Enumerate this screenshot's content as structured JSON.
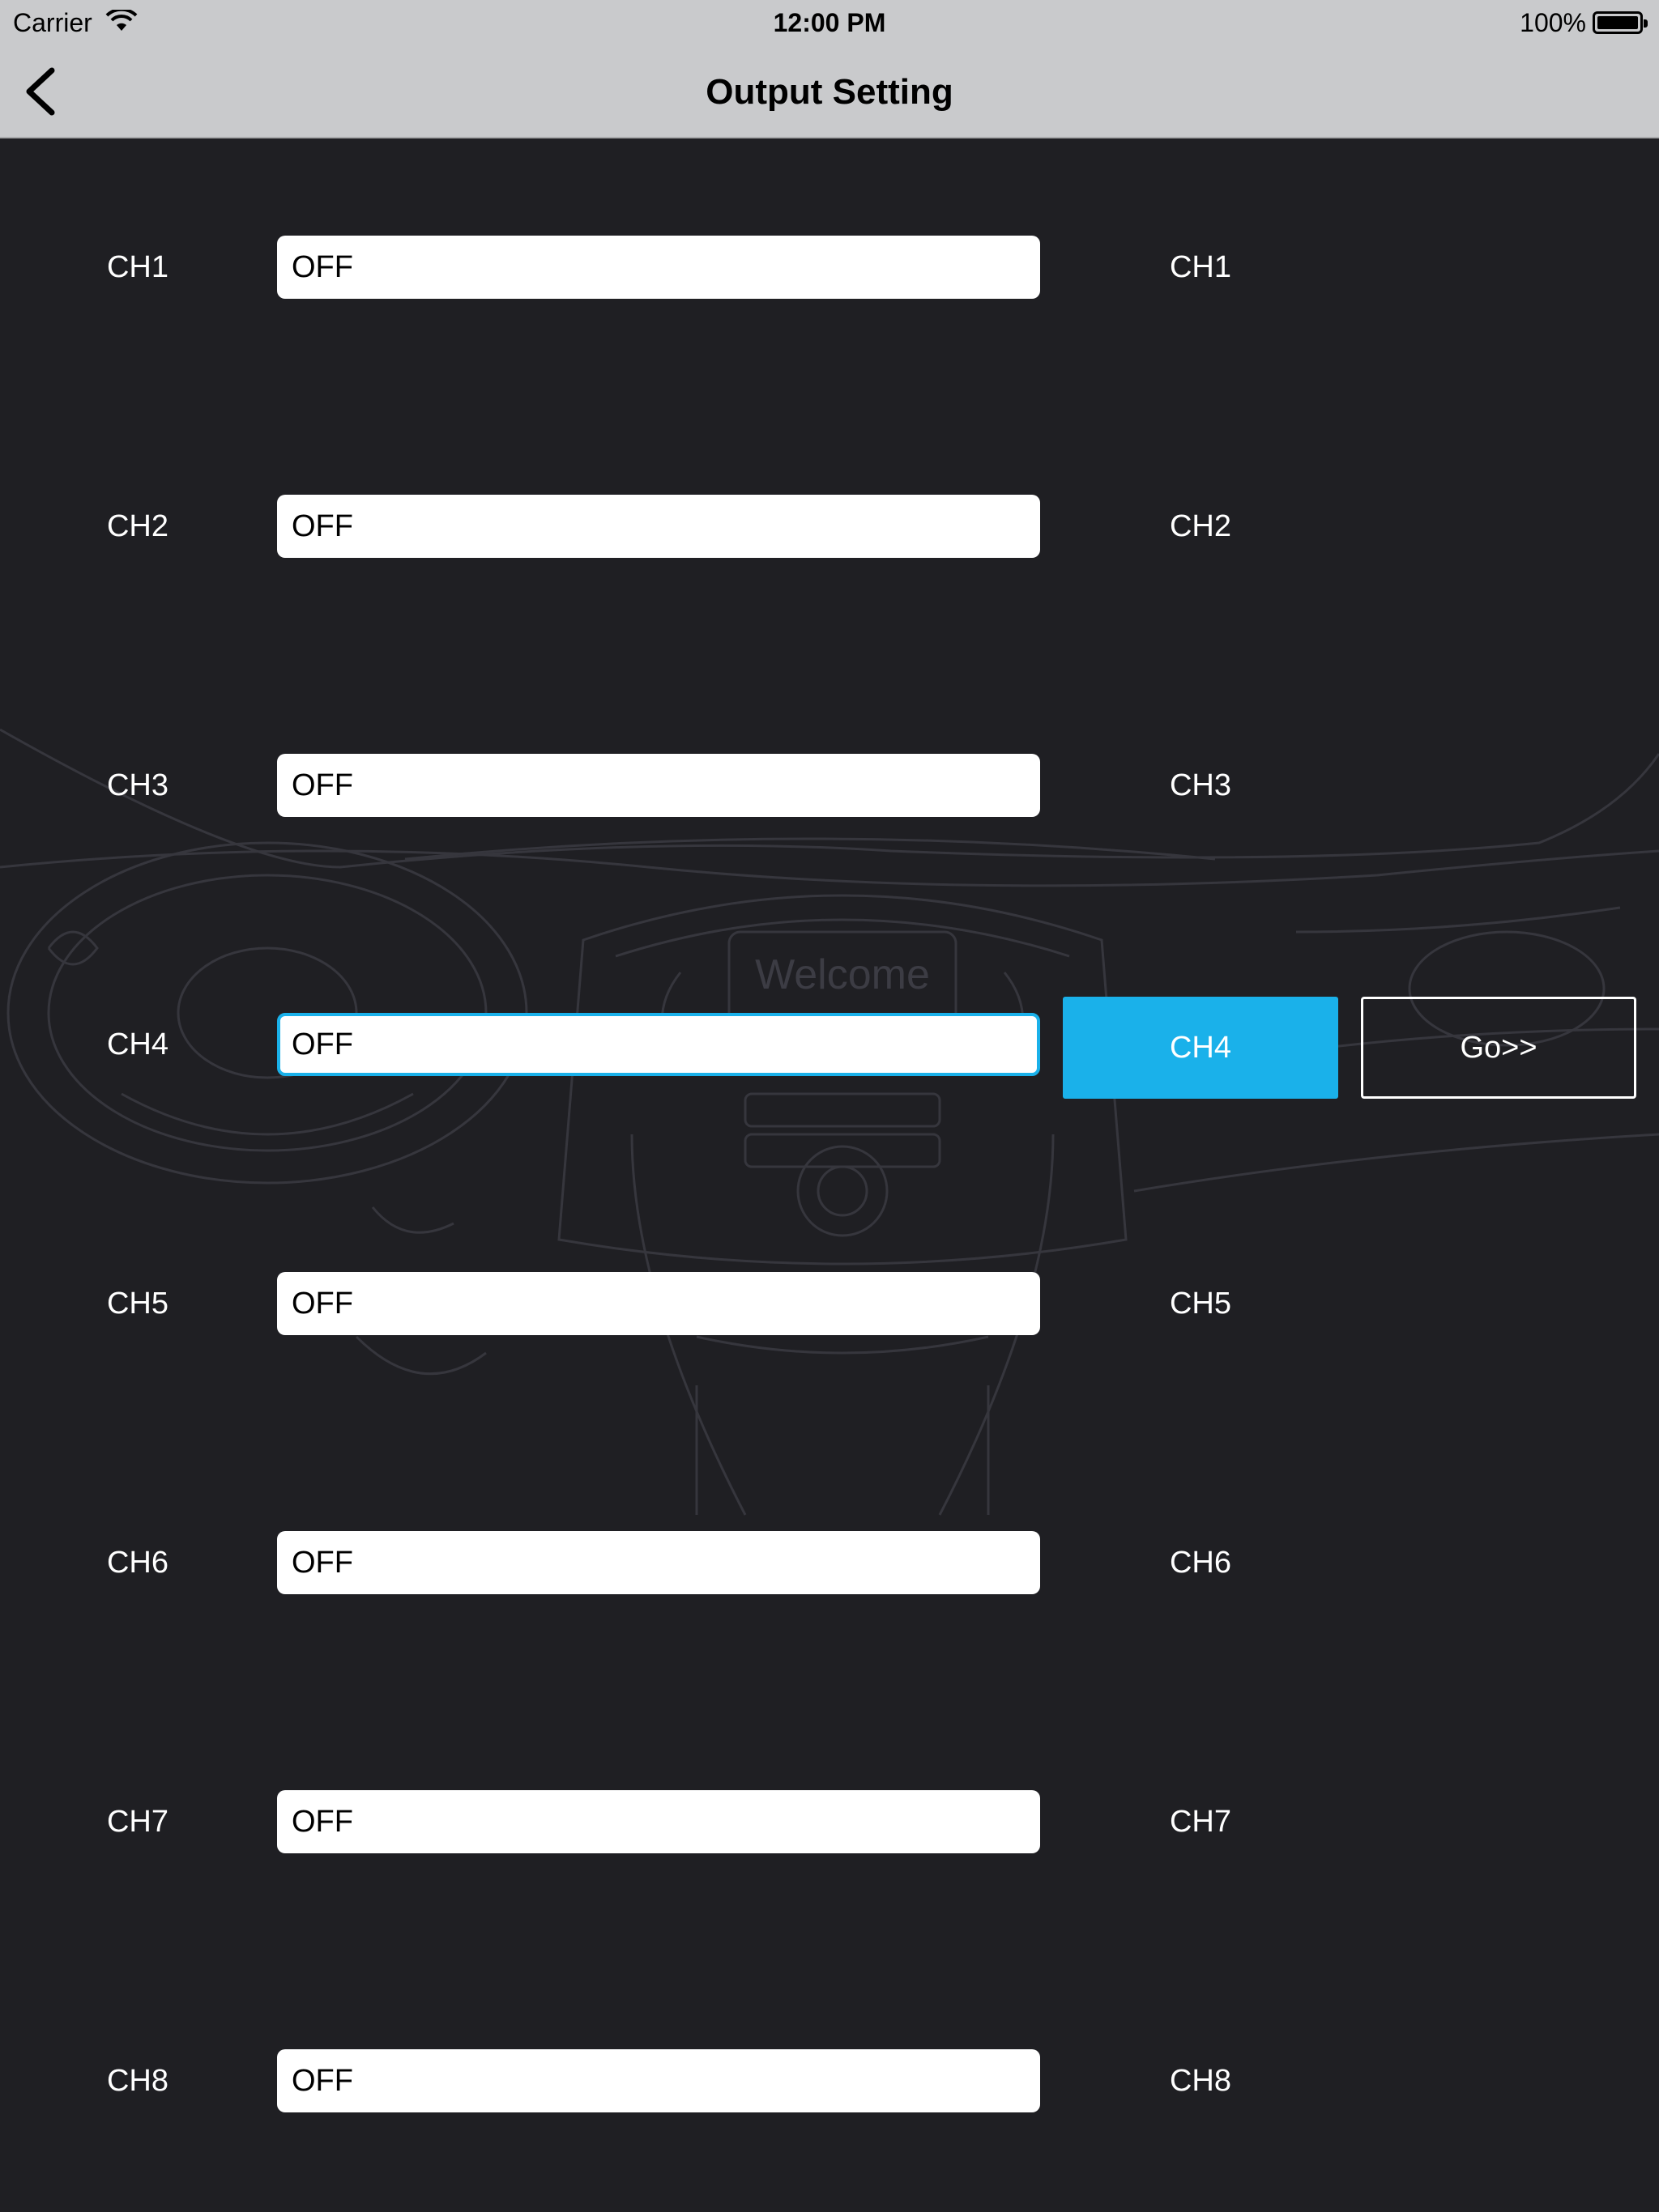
{
  "status_bar": {
    "carrier": "Carrier",
    "time": "12:00 PM",
    "battery": "100%"
  },
  "nav": {
    "title": "Output Setting",
    "back_icon": "chevron-left-icon"
  },
  "background": {
    "watermark_text": "Welcome"
  },
  "channels": [
    {
      "label": "CH1",
      "value": "OFF",
      "button": "CH1"
    },
    {
      "label": "CH2",
      "value": "OFF",
      "button": "CH2"
    },
    {
      "label": "CH3",
      "value": "OFF",
      "button": "CH3"
    },
    {
      "label": "CH4",
      "value": "OFF",
      "button": "CH4"
    },
    {
      "label": "CH5",
      "value": "OFF",
      "button": "CH5"
    },
    {
      "label": "CH6",
      "value": "OFF",
      "button": "CH6"
    },
    {
      "label": "CH7",
      "value": "OFF",
      "button": "CH7"
    },
    {
      "label": "CH8",
      "value": "OFF",
      "button": "CH8"
    }
  ],
  "selected_channel": "CH4",
  "go_button": "Go>>",
  "colors": {
    "accent": "#1ab1ea",
    "background": "#1f1f23",
    "bar": "#c9cacc"
  }
}
